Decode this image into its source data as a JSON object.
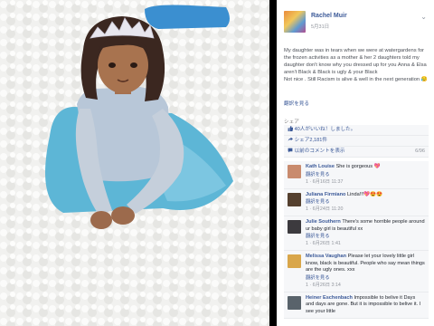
{
  "post": {
    "poster_name": "Rachel Muir",
    "date": "5月31日",
    "body": "My daughter was in tears when we were at watergardens for the frozen activities as a mother & her 2 daughters told my daughter don't know why you dressed up for you Anna & Elsa aren't Black & Black is ugly & your Black\nNot nice . Still Racism is alive & well in the next generation 😥",
    "see_translation": "翻訳を見る",
    "share_label": "シェア"
  },
  "summary": {
    "likes": "40人がいいね！しました。",
    "shares": "シェア2,181件",
    "prev_comments": "以前のコメントを表示",
    "comment_count": "6/96"
  },
  "comments": [
    {
      "name": "Kath Louise",
      "text": "She is gorgeous 💖",
      "link": "翻訳を見る",
      "meta": "1 · 6月16日 11:37",
      "avatar_color": "#c98b6e"
    },
    {
      "name": "Juliana Firmiano",
      "text": "Linda!!!💖😍😍",
      "link": "翻訳を見る",
      "meta": "1 · 6月24日 11:20",
      "avatar_color": "#55402f"
    },
    {
      "name": "Julie Southern",
      "text": "There's some horrible people around ur baby girl is beautiful xx",
      "link": "翻訳を見る",
      "meta": "1 · 6月26日 1:41",
      "avatar_color": "#3c3a3e"
    },
    {
      "name": "Melissa Vaughan",
      "text": "Please let your lovely little girl know, black is beautiful. People who say mean things are the ugly ones. xxx",
      "link": "翻訳を見る",
      "meta": "1 · 6月26日 3:14",
      "avatar_color": "#d9a64a"
    },
    {
      "name": "Heiner Eschenbach",
      "text": "Impossible to belive it Days and days are gone. But it is impossible to belive it. I see your little",
      "link": "",
      "meta": "",
      "avatar_color": "#59636b"
    }
  ],
  "colors": {
    "link_blue": "#3b5998",
    "photo_bg": "#f2f2f0",
    "dress_blue": "#5db6d6"
  }
}
